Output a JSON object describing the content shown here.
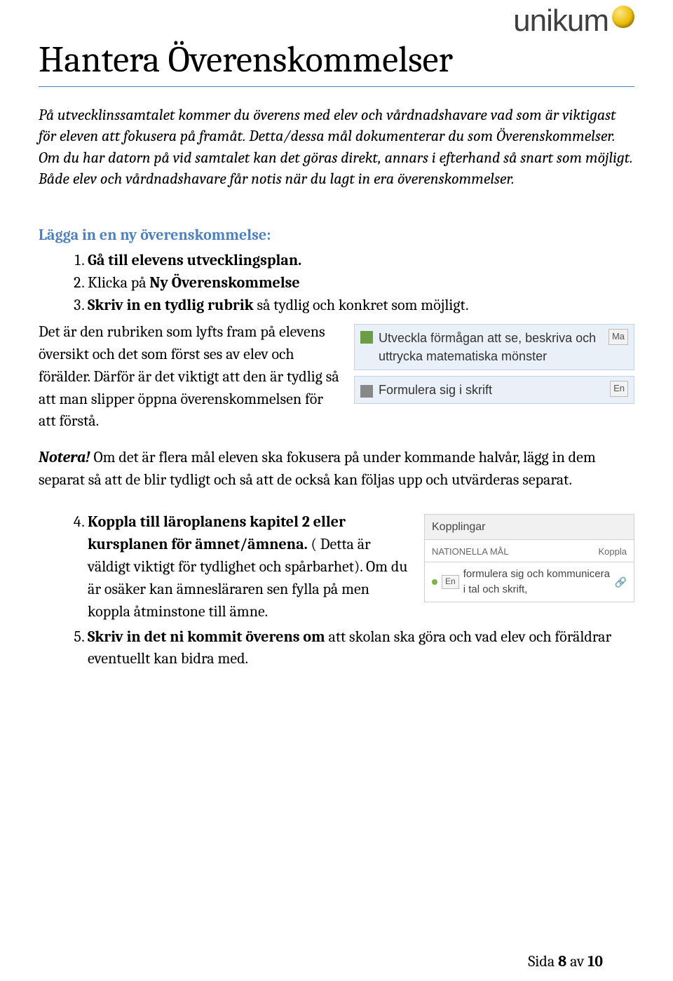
{
  "logo": {
    "text": "unikum"
  },
  "title": "Hantera Överenskommelser",
  "intro": "På utvecklinssamtalet kommer du överens med elev och vårdnadshavare vad som är viktigast för eleven att fokusera på framåt. Detta/dessa mål dokumenterar du som Överenskommelser. Om du har datorn på vid samtalet kan det göras direkt, annars i efterhand så snart som möjligt. Både elev och vårdnadshavare får notis när du lagt in era överenskommelser.",
  "section_heading": "Lägga in en ny överenskommelse:",
  "list1": {
    "item1_bold": "Gå till elevens utvecklingsplan.",
    "item2_pre": "Klicka på ",
    "item2_bold": "Ny Överenskommelse",
    "item3_bold": "Skriv in en tydlig rubrik",
    "item3_rest": " så tydlig och konkret som möjligt."
  },
  "after_list_text": "Det är den rubriken som lyfts fram på elevens översikt och det som först ses av elev och förälder. Därför är det viktigt att den är tydlig så att man slipper öppna överenskommelsen för att förstå.",
  "snippet1": {
    "row1_text": "Utveckla förmågan att se, beskriva och uttrycka matematiska mönster",
    "row1_tag": "Ma",
    "row2_text": "Formulera sig i skrift",
    "row2_tag": "En"
  },
  "notera": {
    "bold": "Notera!",
    "text": " Om det är flera mål eleven ska fokusera på under kommande halvår, lägg in dem separat så att de blir tydligt och så att de också kan följas upp och utvärderas separat."
  },
  "list2": {
    "item4_bold": "Koppla till läroplanens kapitel 2 eller kursplanen för ämnet/ämnena.",
    "item4_rest": " ( Detta är väldigt viktigt för tydlighet och spårbarhet). Om du är osäker kan ämnesläraren sen fylla på men koppla åtminstone till ämne.",
    "item5_bold": "Skriv in det ni kommit överens om",
    "item5_rest": " att skolan ska göra och vad elev och föräldrar eventuellt kan bidra med."
  },
  "kopplingar": {
    "head": "Kopplingar",
    "sub_left": "NATIONELLA MÅL",
    "sub_right": "Koppla",
    "item_tag": "En",
    "item_text": "formulera sig och kommunicera i tal och skrift,"
  },
  "footer": {
    "pre": "Sida ",
    "page": "8",
    "mid": " av ",
    "total": "10"
  }
}
